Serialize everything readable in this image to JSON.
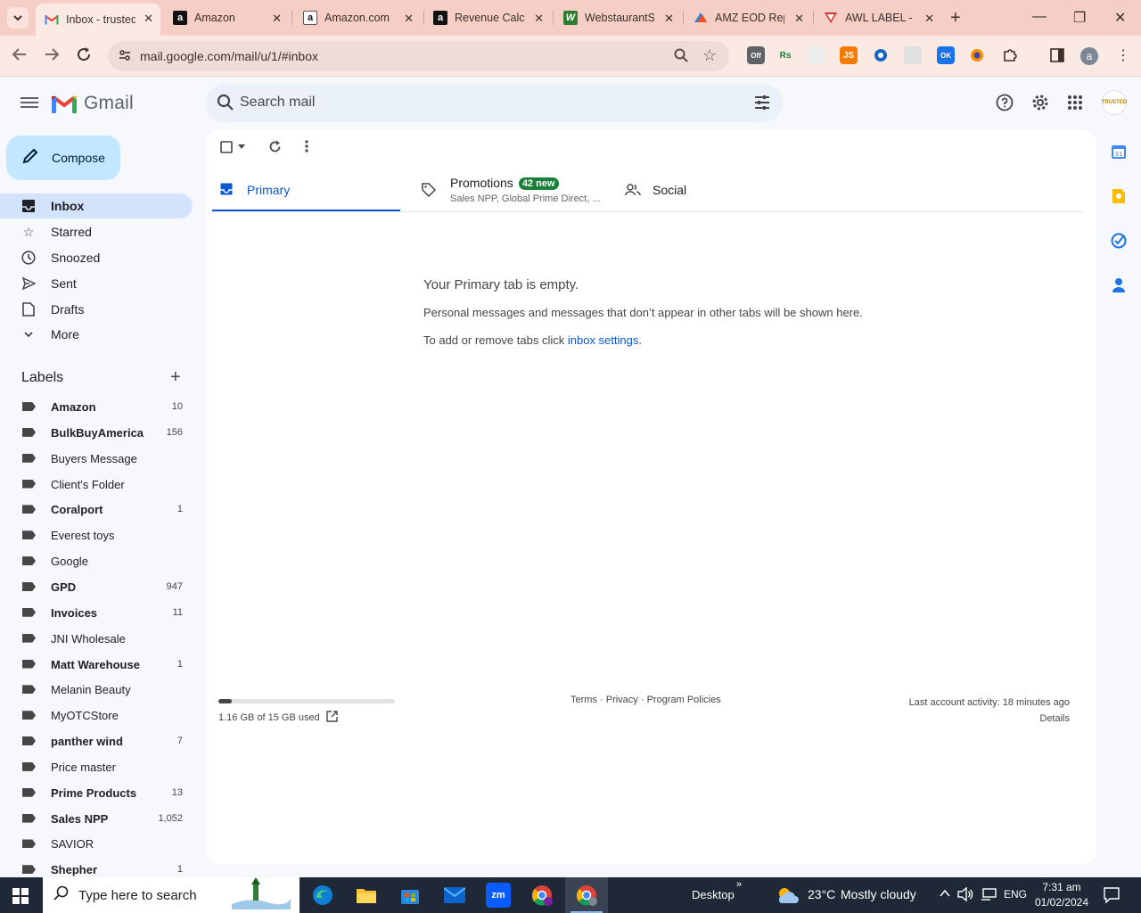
{
  "browser": {
    "tabs": [
      {
        "title": "Inbox - trusted",
        "favicon": "gmail-icon",
        "active": true
      },
      {
        "title": "Amazon",
        "favicon": "amazon-icon",
        "active": false
      },
      {
        "title": "Amazon.com",
        "favicon": "amazon-icon",
        "active": false
      },
      {
        "title": "Revenue Calcu",
        "favicon": "amazon-icon",
        "active": false
      },
      {
        "title": "WebstaurantS",
        "favicon": "webstaurant-icon",
        "active": false
      },
      {
        "title": "AMZ EOD Rep",
        "favicon": "amz-report-icon",
        "active": false
      },
      {
        "title": "AWL LABEL -",
        "favicon": "awl-icon",
        "active": false
      }
    ],
    "url": "mail.google.com/mail/u/1/#inbox",
    "profile_initial": "a",
    "extensions": [
      {
        "name": "off-extension",
        "label": "Off",
        "color": "#5f6368"
      },
      {
        "name": "rs-extension",
        "label": "Rs",
        "color": "#188038"
      },
      {
        "name": "seller-extension",
        "label": "",
        "color": "#e8e8e8"
      },
      {
        "name": "js-extension",
        "label": "JS",
        "color": "#f57c00"
      },
      {
        "name": "keepa-extension",
        "label": "",
        "color": "#1565c0"
      },
      {
        "name": "helper-extension",
        "label": "",
        "color": "#e0e0e0"
      },
      {
        "name": "ok-extension",
        "label": "OK",
        "color": "#1a73e8"
      },
      {
        "name": "firefox-like-extension",
        "label": "",
        "color": "#ff8f00"
      }
    ]
  },
  "gmail": {
    "brand": "Gmail",
    "search_placeholder": "Search mail",
    "compose_label": "Compose",
    "nav": [
      {
        "id": "inbox",
        "label": "Inbox",
        "icon": "inbox-icon",
        "active": true
      },
      {
        "id": "starred",
        "label": "Starred",
        "icon": "star-icon",
        "active": false
      },
      {
        "id": "snoozed",
        "label": "Snoozed",
        "icon": "clock-icon",
        "active": false
      },
      {
        "id": "sent",
        "label": "Sent",
        "icon": "send-icon",
        "active": false
      },
      {
        "id": "drafts",
        "label": "Drafts",
        "icon": "draft-icon",
        "active": false
      },
      {
        "id": "more",
        "label": "More",
        "icon": "chevron-down-icon",
        "active": false
      }
    ],
    "labels_title": "Labels",
    "labels": [
      {
        "name": "Amazon",
        "count": "10",
        "bold": true
      },
      {
        "name": "BulkBuyAmerica",
        "count": "156",
        "bold": true
      },
      {
        "name": "Buyers Message",
        "count": "",
        "bold": false
      },
      {
        "name": "Client's Folder",
        "count": "",
        "bold": false
      },
      {
        "name": "Coralport",
        "count": "1",
        "bold": true
      },
      {
        "name": "Everest toys",
        "count": "",
        "bold": false
      },
      {
        "name": "Google",
        "count": "",
        "bold": false
      },
      {
        "name": "GPD",
        "count": "947",
        "bold": true
      },
      {
        "name": "Invoices",
        "count": "11",
        "bold": true
      },
      {
        "name": "JNI Wholesale",
        "count": "",
        "bold": false
      },
      {
        "name": "Matt Warehouse",
        "count": "1",
        "bold": true
      },
      {
        "name": "Melanin Beauty",
        "count": "",
        "bold": false
      },
      {
        "name": "MyOTCStore",
        "count": "",
        "bold": false
      },
      {
        "name": "panther wind",
        "count": "7",
        "bold": true
      },
      {
        "name": "Price master",
        "count": "",
        "bold": false
      },
      {
        "name": "Prime Products",
        "count": "13",
        "bold": true
      },
      {
        "name": "Sales NPP",
        "count": "1,052",
        "bold": true
      },
      {
        "name": "SAVIOR",
        "count": "",
        "bold": false
      },
      {
        "name": "Shepher",
        "count": "1",
        "bold": true
      }
    ],
    "inbox_tabs": {
      "primary": "Primary",
      "promotions": "Promotions",
      "promotions_badge": "42 new",
      "promotions_snippet": "Sales NPP, Global Prime Direct, ...",
      "social": "Social"
    },
    "empty": {
      "title": "Your Primary tab is empty.",
      "description": "Personal messages and messages that don’t appear in other tabs will be shown here.",
      "settings_prefix": "To add or remove tabs click ",
      "settings_link": "inbox settings",
      "settings_suffix": "."
    },
    "storage": {
      "text": "1.16 GB of 15 GB used",
      "used_fraction": 0.077
    },
    "footer": {
      "terms": "Terms",
      "privacy": "Privacy",
      "policies": "Program Policies",
      "activity": "Last account activity: 18 minutes ago",
      "details": "Details"
    },
    "account_badge": "TRUSTED"
  },
  "taskbar": {
    "search_placeholder": "Type here to search",
    "desktop_label": "Desktop",
    "weather_temp": "23°C",
    "weather_text": "Mostly cloudy",
    "language": "ENG",
    "time": "7:31 am",
    "date": "01/02/2024"
  }
}
